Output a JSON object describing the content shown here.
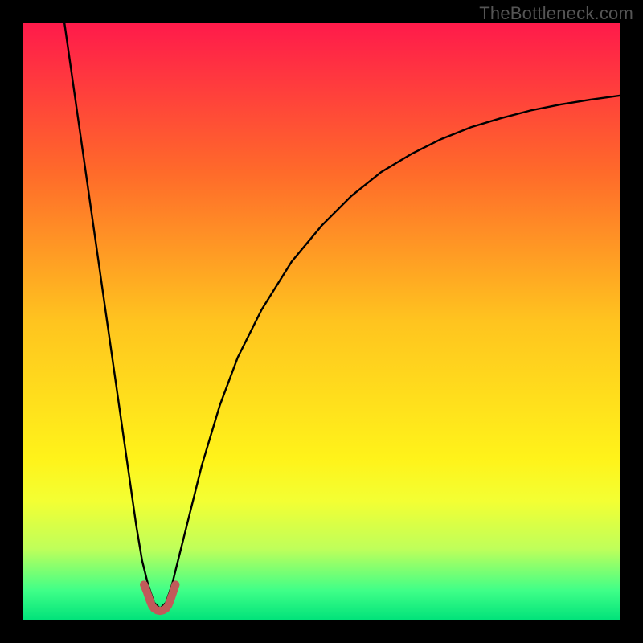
{
  "watermark": "TheBottleneck.com",
  "chart_data": {
    "type": "line",
    "title": "",
    "xlabel": "",
    "ylabel": "",
    "xlim": [
      0,
      100
    ],
    "ylim": [
      0,
      100
    ],
    "grid": false,
    "legend": false,
    "background_gradient": {
      "stops": [
        {
          "offset": 0.0,
          "color": "#ff1a4b"
        },
        {
          "offset": 0.25,
          "color": "#ff6a2a"
        },
        {
          "offset": 0.5,
          "color": "#ffc41f"
        },
        {
          "offset": 0.73,
          "color": "#fff31a"
        },
        {
          "offset": 0.8,
          "color": "#f3ff33"
        },
        {
          "offset": 0.88,
          "color": "#bfff5a"
        },
        {
          "offset": 0.95,
          "color": "#3fff88"
        },
        {
          "offset": 1.0,
          "color": "#00e27a"
        }
      ]
    },
    "series": [
      {
        "name": "bottleneck-curve",
        "stroke": "#000000",
        "stroke_width": 2.4,
        "x": [
          7,
          8,
          9,
          10,
          11,
          12,
          13,
          14,
          15,
          16,
          17,
          18,
          19,
          20,
          21,
          22,
          23,
          24,
          25,
          26,
          28,
          30,
          33,
          36,
          40,
          45,
          50,
          55,
          60,
          65,
          70,
          75,
          80,
          85,
          90,
          95,
          100
        ],
        "y": [
          100,
          93,
          86,
          79,
          72,
          65,
          58,
          51,
          44,
          37,
          30,
          23,
          16,
          10,
          6,
          3,
          2,
          3,
          6,
          10,
          18,
          26,
          36,
          44,
          52,
          60,
          66,
          71,
          75,
          78,
          80.5,
          82.5,
          84,
          85.3,
          86.3,
          87.1,
          87.8
        ]
      },
      {
        "name": "valley-marker",
        "stroke": "#c15a5a",
        "stroke_width": 10,
        "linecap": "round",
        "x": [
          20.3,
          20.8,
          21.2,
          21.6,
          22.0,
          22.5,
          23.0,
          23.5,
          24.0,
          24.4,
          24.8,
          25.2,
          25.6
        ],
        "y": [
          6.0,
          4.8,
          3.6,
          2.6,
          2.0,
          1.7,
          1.6,
          1.7,
          2.0,
          2.6,
          3.6,
          4.8,
          6.0
        ]
      }
    ]
  }
}
